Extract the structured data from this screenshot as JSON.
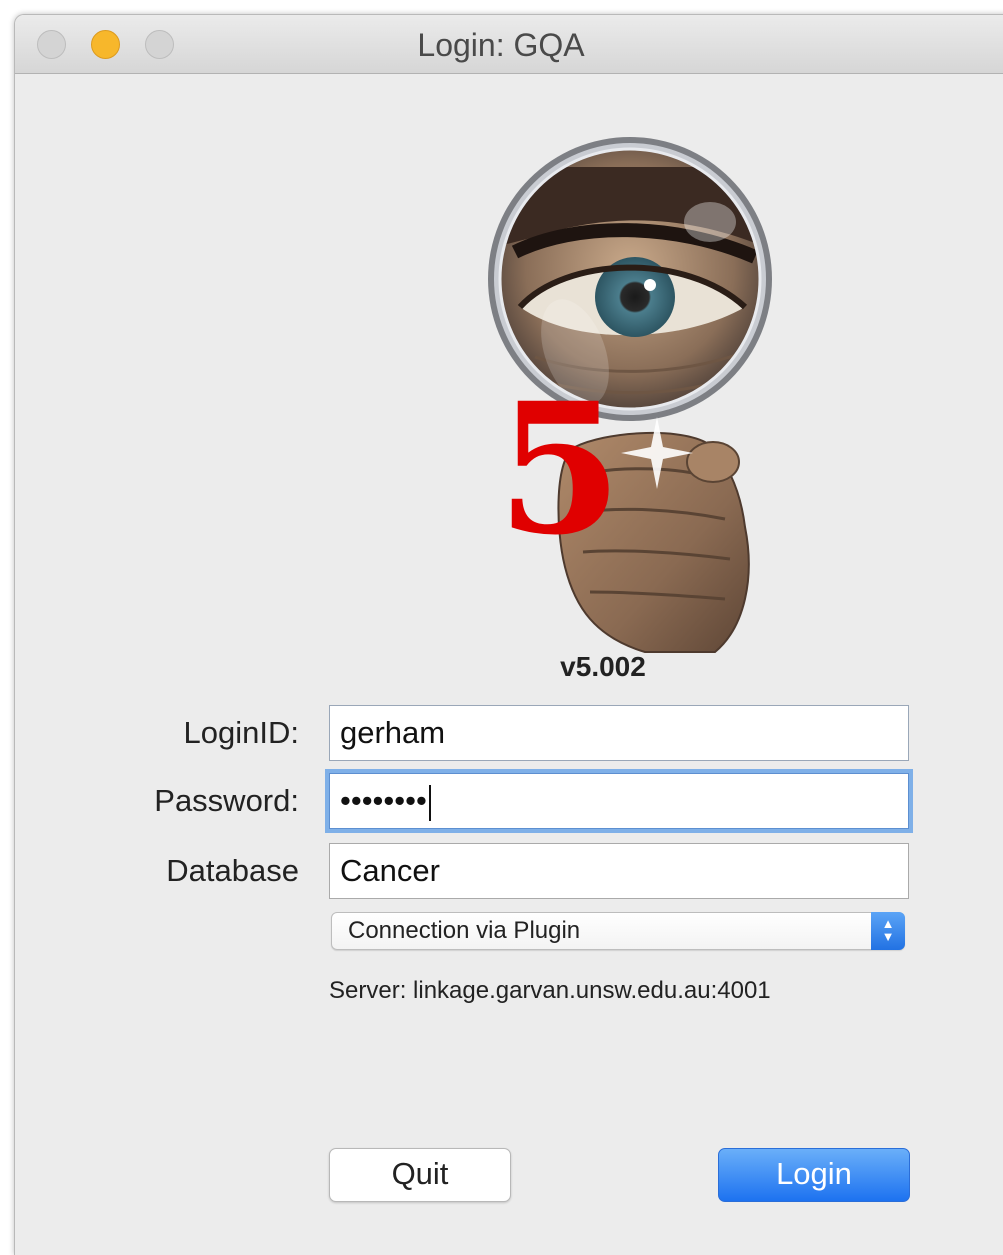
{
  "window": {
    "title": "Login: GQA"
  },
  "logo": {
    "number": "5"
  },
  "app": {
    "version": "v5.002"
  },
  "form": {
    "login_label": "LoginID:",
    "login_value": "gerham",
    "password_label": "Password:",
    "password_value": "••••••••",
    "database_label": "Database",
    "database_value": "Cancer",
    "connection_selected": "Connection via Plugin",
    "server_text": "Server: linkage.garvan.unsw.edu.au:4001"
  },
  "buttons": {
    "quit_label": "Quit",
    "login_label": "Login"
  },
  "colors": {
    "accent": "#1d72f0",
    "logo_number": "#e00000",
    "traffic_minimize": "#f7b72b"
  }
}
